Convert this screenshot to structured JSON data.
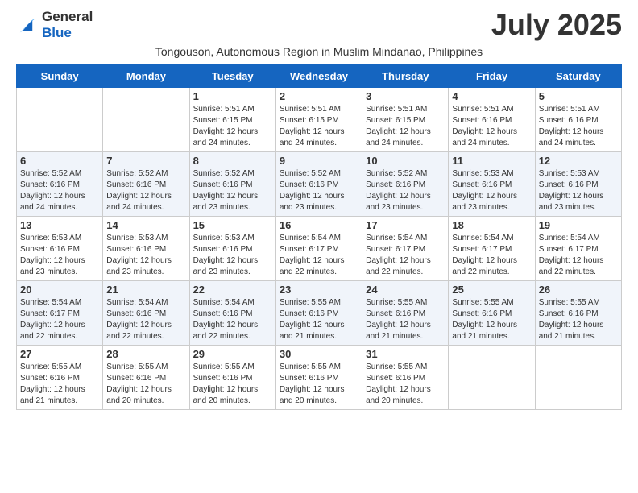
{
  "header": {
    "logo_general": "General",
    "logo_blue": "Blue",
    "month_title": "July 2025",
    "subtitle": "Tongouson, Autonomous Region in Muslim Mindanao, Philippines"
  },
  "calendar": {
    "days_of_week": [
      "Sunday",
      "Monday",
      "Tuesday",
      "Wednesday",
      "Thursday",
      "Friday",
      "Saturday"
    ],
    "weeks": [
      [
        {
          "day": "",
          "info": ""
        },
        {
          "day": "",
          "info": ""
        },
        {
          "day": "1",
          "info": "Sunrise: 5:51 AM\nSunset: 6:15 PM\nDaylight: 12 hours and 24 minutes."
        },
        {
          "day": "2",
          "info": "Sunrise: 5:51 AM\nSunset: 6:15 PM\nDaylight: 12 hours and 24 minutes."
        },
        {
          "day": "3",
          "info": "Sunrise: 5:51 AM\nSunset: 6:15 PM\nDaylight: 12 hours and 24 minutes."
        },
        {
          "day": "4",
          "info": "Sunrise: 5:51 AM\nSunset: 6:16 PM\nDaylight: 12 hours and 24 minutes."
        },
        {
          "day": "5",
          "info": "Sunrise: 5:51 AM\nSunset: 6:16 PM\nDaylight: 12 hours and 24 minutes."
        }
      ],
      [
        {
          "day": "6",
          "info": "Sunrise: 5:52 AM\nSunset: 6:16 PM\nDaylight: 12 hours and 24 minutes."
        },
        {
          "day": "7",
          "info": "Sunrise: 5:52 AM\nSunset: 6:16 PM\nDaylight: 12 hours and 24 minutes."
        },
        {
          "day": "8",
          "info": "Sunrise: 5:52 AM\nSunset: 6:16 PM\nDaylight: 12 hours and 23 minutes."
        },
        {
          "day": "9",
          "info": "Sunrise: 5:52 AM\nSunset: 6:16 PM\nDaylight: 12 hours and 23 minutes."
        },
        {
          "day": "10",
          "info": "Sunrise: 5:52 AM\nSunset: 6:16 PM\nDaylight: 12 hours and 23 minutes."
        },
        {
          "day": "11",
          "info": "Sunrise: 5:53 AM\nSunset: 6:16 PM\nDaylight: 12 hours and 23 minutes."
        },
        {
          "day": "12",
          "info": "Sunrise: 5:53 AM\nSunset: 6:16 PM\nDaylight: 12 hours and 23 minutes."
        }
      ],
      [
        {
          "day": "13",
          "info": "Sunrise: 5:53 AM\nSunset: 6:16 PM\nDaylight: 12 hours and 23 minutes."
        },
        {
          "day": "14",
          "info": "Sunrise: 5:53 AM\nSunset: 6:16 PM\nDaylight: 12 hours and 23 minutes."
        },
        {
          "day": "15",
          "info": "Sunrise: 5:53 AM\nSunset: 6:16 PM\nDaylight: 12 hours and 23 minutes."
        },
        {
          "day": "16",
          "info": "Sunrise: 5:54 AM\nSunset: 6:17 PM\nDaylight: 12 hours and 22 minutes."
        },
        {
          "day": "17",
          "info": "Sunrise: 5:54 AM\nSunset: 6:17 PM\nDaylight: 12 hours and 22 minutes."
        },
        {
          "day": "18",
          "info": "Sunrise: 5:54 AM\nSunset: 6:17 PM\nDaylight: 12 hours and 22 minutes."
        },
        {
          "day": "19",
          "info": "Sunrise: 5:54 AM\nSunset: 6:17 PM\nDaylight: 12 hours and 22 minutes."
        }
      ],
      [
        {
          "day": "20",
          "info": "Sunrise: 5:54 AM\nSunset: 6:17 PM\nDaylight: 12 hours and 22 minutes."
        },
        {
          "day": "21",
          "info": "Sunrise: 5:54 AM\nSunset: 6:16 PM\nDaylight: 12 hours and 22 minutes."
        },
        {
          "day": "22",
          "info": "Sunrise: 5:54 AM\nSunset: 6:16 PM\nDaylight: 12 hours and 22 minutes."
        },
        {
          "day": "23",
          "info": "Sunrise: 5:55 AM\nSunset: 6:16 PM\nDaylight: 12 hours and 21 minutes."
        },
        {
          "day": "24",
          "info": "Sunrise: 5:55 AM\nSunset: 6:16 PM\nDaylight: 12 hours and 21 minutes."
        },
        {
          "day": "25",
          "info": "Sunrise: 5:55 AM\nSunset: 6:16 PM\nDaylight: 12 hours and 21 minutes."
        },
        {
          "day": "26",
          "info": "Sunrise: 5:55 AM\nSunset: 6:16 PM\nDaylight: 12 hours and 21 minutes."
        }
      ],
      [
        {
          "day": "27",
          "info": "Sunrise: 5:55 AM\nSunset: 6:16 PM\nDaylight: 12 hours and 21 minutes."
        },
        {
          "day": "28",
          "info": "Sunrise: 5:55 AM\nSunset: 6:16 PM\nDaylight: 12 hours and 20 minutes."
        },
        {
          "day": "29",
          "info": "Sunrise: 5:55 AM\nSunset: 6:16 PM\nDaylight: 12 hours and 20 minutes."
        },
        {
          "day": "30",
          "info": "Sunrise: 5:55 AM\nSunset: 6:16 PM\nDaylight: 12 hours and 20 minutes."
        },
        {
          "day": "31",
          "info": "Sunrise: 5:55 AM\nSunset: 6:16 PM\nDaylight: 12 hours and 20 minutes."
        },
        {
          "day": "",
          "info": ""
        },
        {
          "day": "",
          "info": ""
        }
      ]
    ]
  }
}
